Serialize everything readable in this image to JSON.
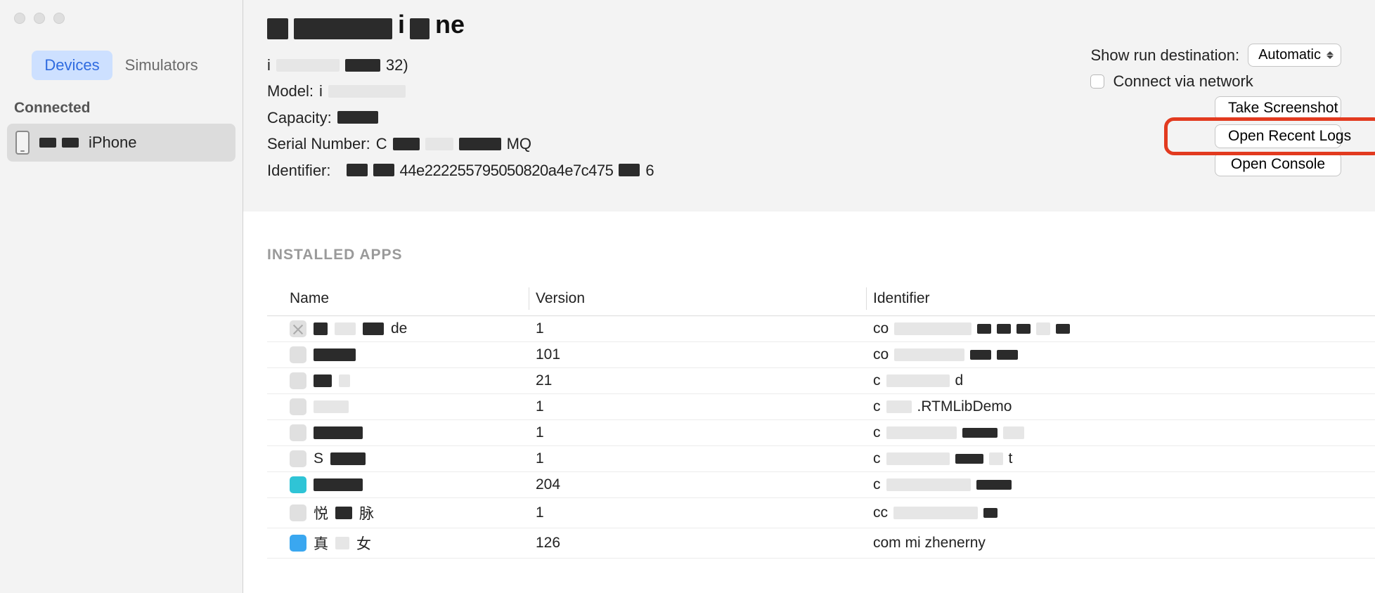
{
  "sidebar": {
    "tabs": {
      "devices": "Devices",
      "simulators": "Simulators"
    },
    "section_header": "Connected",
    "device": {
      "label": "iPhone"
    }
  },
  "header": {
    "title_suffix": "ne",
    "info": {
      "os_prefix": "i",
      "os_suffix": "32)",
      "model_label": "Model:",
      "model_value_prefix": "i",
      "capacity_label": "Capacity:",
      "serial_label": "Serial Number:",
      "serial_prefix": "C",
      "serial_suffix": "MQ",
      "identifier_label": "Identifier:",
      "identifier_mid": "44e222255795050820a4e7c475",
      "identifier_suffix": "6"
    },
    "controls": {
      "run_dest_label": "Show run destination:",
      "run_dest_value": "Automatic",
      "connect_network": "Connect via network",
      "take_screenshot": "Take Screenshot",
      "open_recent_logs": "Open Recent Logs",
      "open_console": "Open Console"
    }
  },
  "apps": {
    "section_title": "INSTALLED APPS",
    "columns": {
      "name": "Name",
      "version": "Version",
      "identifier": "Identifier"
    },
    "rows": [
      {
        "name_suffix": "de",
        "version": "1",
        "id_prefix": "co"
      },
      {
        "name_suffix": "",
        "version": "101",
        "id_prefix": "co"
      },
      {
        "name_suffix": "",
        "version": "21",
        "id_prefix": "c",
        "id_suffix": "d"
      },
      {
        "name_suffix": "",
        "version": "1",
        "id_prefix": "c",
        "id_mid": ".RTMLibDemo"
      },
      {
        "name_suffix": "",
        "version": "1",
        "id_prefix": "c"
      },
      {
        "name_prefix": "S",
        "version": "1",
        "id_prefix": "c",
        "id_suffix": "t"
      },
      {
        "name_suffix": "",
        "version": "204",
        "id_prefix": "c"
      },
      {
        "name_prefix": "悦",
        "name_suffix": "脉",
        "version": "1",
        "id_prefix": "cc"
      },
      {
        "name_prefix": "真",
        "name_suffix": "女",
        "version": "126",
        "id_prefix": "com mi zhenerny"
      }
    ]
  }
}
